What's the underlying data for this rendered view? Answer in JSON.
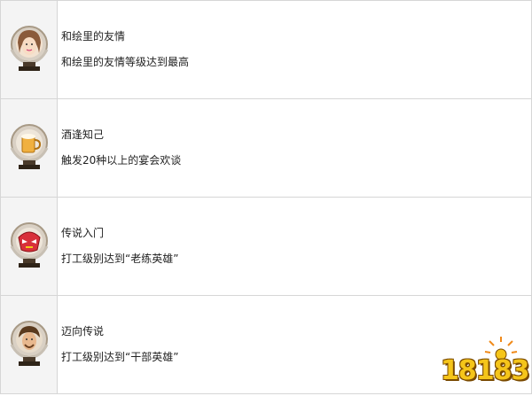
{
  "achievements": [
    {
      "title": "和绘里的友情",
      "description": "和绘里的友情等级达到最高",
      "icon": "girl-portrait-trophy"
    },
    {
      "title": "酒逢知己",
      "description": "触发20种以上的宴会欢谈",
      "icon": "beer-mug-trophy"
    },
    {
      "title": "传说入门",
      "description": "打工级别达到“老练英雄”",
      "icon": "red-mask-trophy"
    },
    {
      "title": "迈向传说",
      "description": "打工级别达到“干部英雄”",
      "icon": "man-portrait-trophy"
    }
  ],
  "watermark": {
    "text": "18183"
  }
}
